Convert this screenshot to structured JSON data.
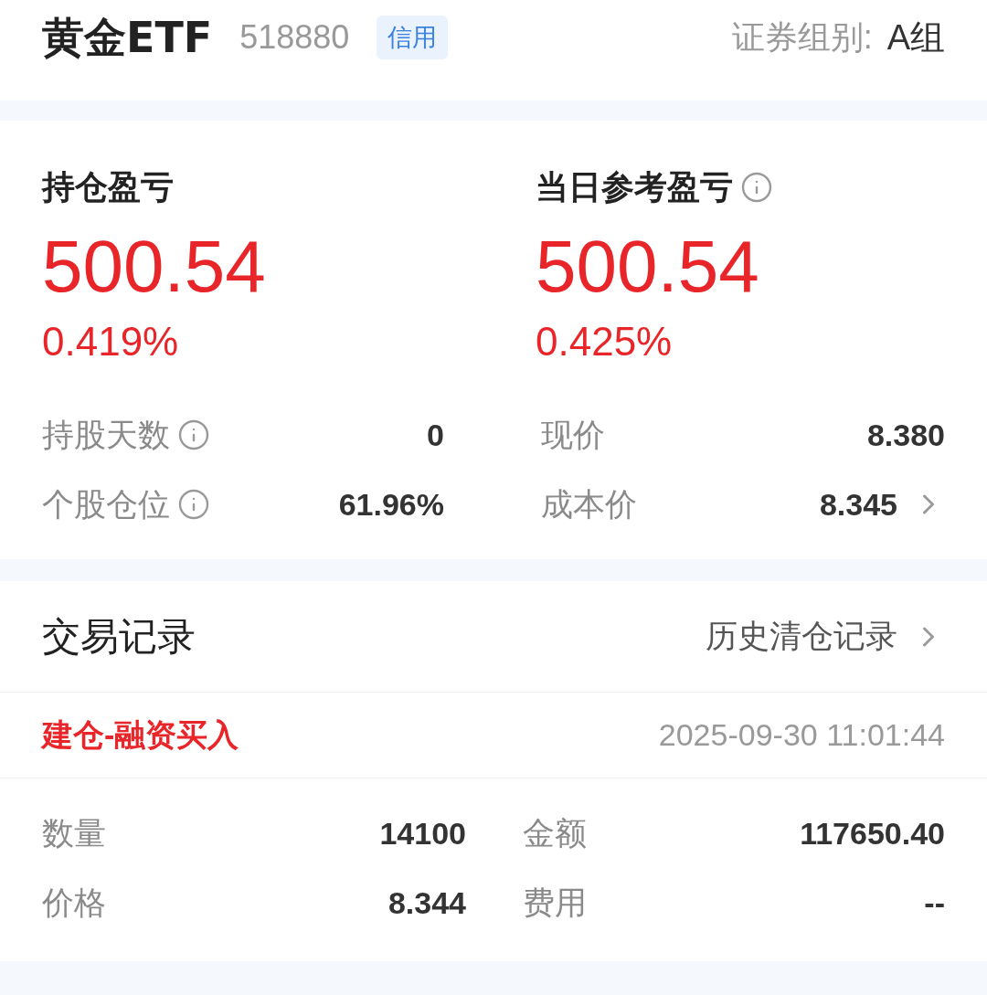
{
  "header": {
    "name": "黄金ETF",
    "code": "518880",
    "badge": "信用",
    "group_label": "证券组别:",
    "group_value": "A组"
  },
  "summary": [
    {
      "label": "持仓盈亏",
      "info": false,
      "value": "500.54",
      "percent": "0.419%"
    },
    {
      "label": "当日参考盈亏",
      "info": true,
      "value": "500.54",
      "percent": "0.425%"
    }
  ],
  "stats": [
    [
      {
        "label": "持股天数",
        "info": true,
        "value": "0",
        "link": false
      },
      {
        "label": "个股仓位",
        "info": true,
        "value": "61.96%",
        "link": false
      }
    ],
    [
      {
        "label": "现价",
        "info": false,
        "value": "8.380",
        "link": false
      },
      {
        "label": "成本价",
        "info": false,
        "value": "8.345",
        "link": true
      }
    ]
  ],
  "trades": {
    "title": "交易记录",
    "history_link": "历史清仓记录",
    "records": [
      {
        "type": "建仓-融资买入",
        "time": "2025-09-30 11:01:44",
        "fields": [
          {
            "label": "数量",
            "value": "14100"
          },
          {
            "label": "金额",
            "value": "117650.40"
          },
          {
            "label": "价格",
            "value": "8.344"
          },
          {
            "label": "费用",
            "value": "--"
          }
        ]
      }
    ]
  }
}
